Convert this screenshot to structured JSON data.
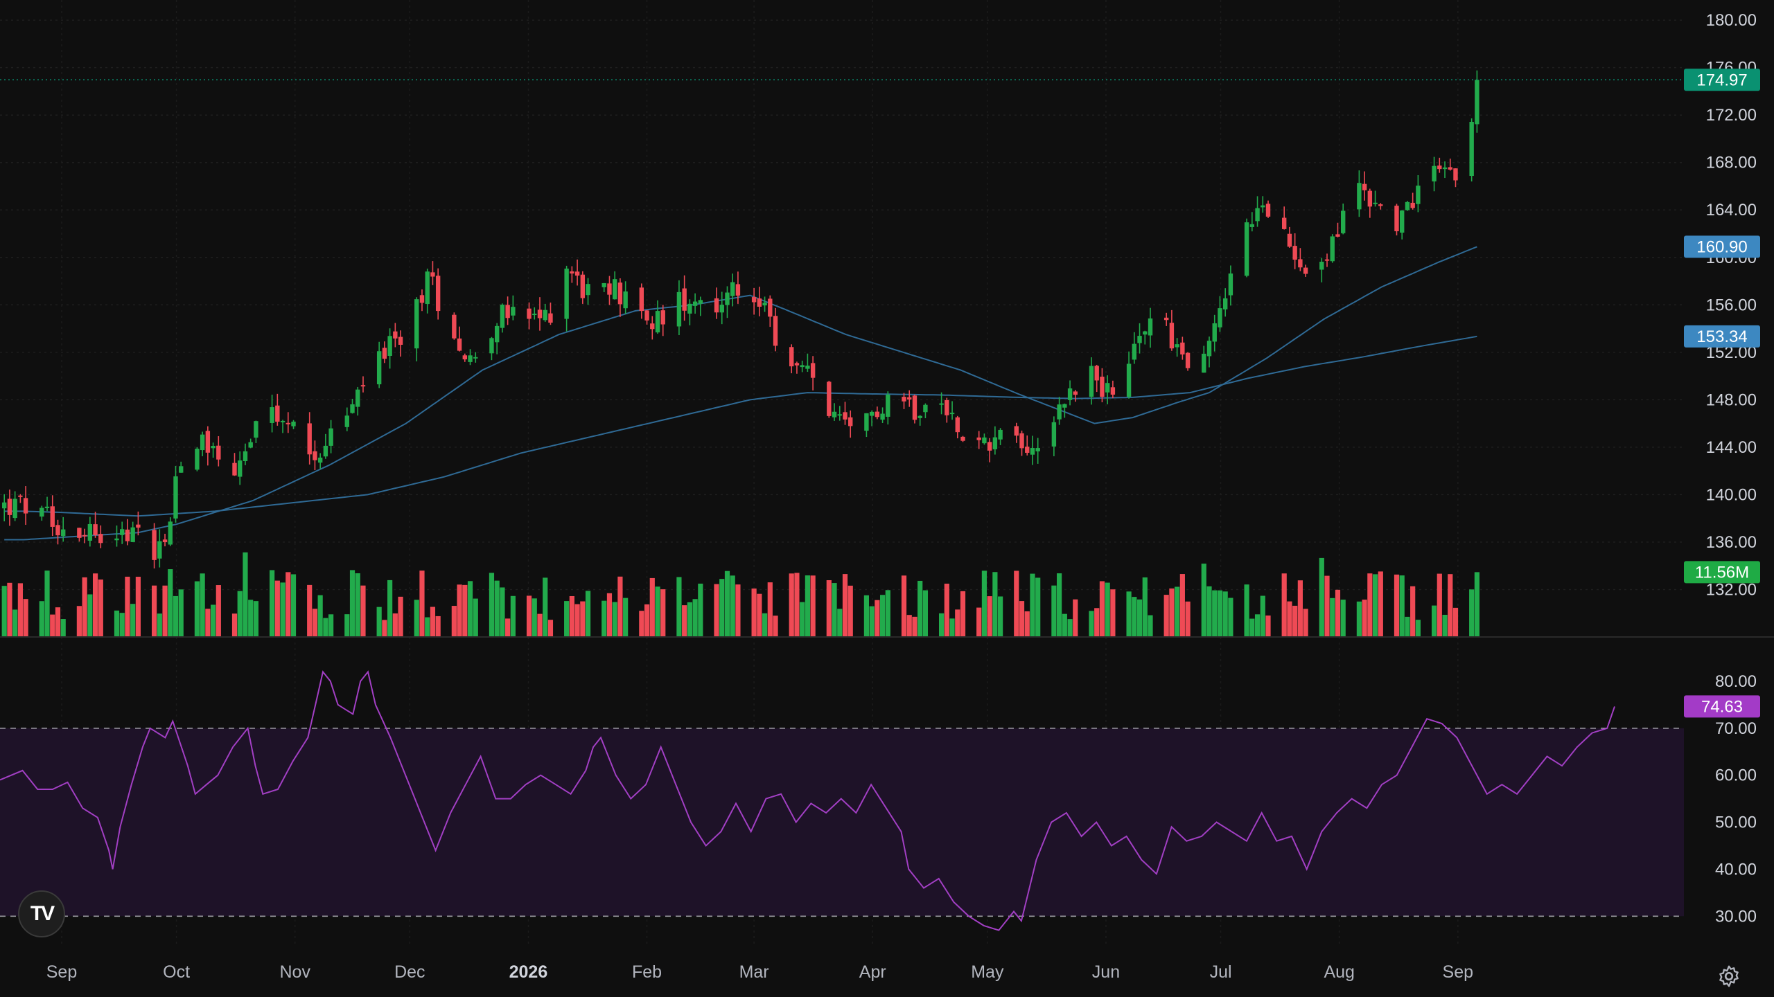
{
  "logo": {
    "text": "TV"
  },
  "icons": {
    "logo": "tradingview-logo-icon",
    "settings": "settings-gear-icon"
  },
  "colors": {
    "background": "#0f0f0f",
    "up": "#22ab4c",
    "down": "#ef4a55",
    "ma_line": "#2f6a95",
    "rsi_line": "#a23fc4",
    "rsi_band": "#1e1228",
    "price_badge": "#0a9171",
    "ma_badge": "#3d88c1",
    "volume_badge": "#1fab45",
    "rsi_badge": "#a33bc7"
  },
  "chart_data": {
    "type": "candlestick",
    "x_axis": {
      "ticks": [
        {
          "label": "Sep",
          "day": 0
        },
        {
          "label": "Oct",
          "day": 30
        },
        {
          "label": "Nov",
          "day": 61
        },
        {
          "label": "Dec",
          "day": 91
        },
        {
          "label": "2026",
          "day": 122,
          "bold": true
        },
        {
          "label": "Feb",
          "day": 153
        },
        {
          "label": "Mar",
          "day": 181
        },
        {
          "label": "Apr",
          "day": 212
        },
        {
          "label": "May",
          "day": 242
        },
        {
          "label": "Jun",
          "day": 273
        },
        {
          "label": "Jul",
          "day": 303
        },
        {
          "label": "Aug",
          "day": 334
        },
        {
          "label": "Sep",
          "day": 365
        }
      ]
    },
    "price_axis": {
      "ylim": [
        128,
        181
      ],
      "ticks": [
        180,
        176,
        172,
        168,
        164,
        160,
        156,
        152,
        148,
        144,
        140,
        136,
        132
      ],
      "tick_labels": [
        "180.00",
        "176.00",
        "172.00",
        "168.00",
        "164.00",
        "160.00",
        "156.00",
        "152.00",
        "148.00",
        "144.00",
        "140.00",
        "136.00",
        "132.00"
      ]
    },
    "price_waypoints": [
      [
        -10,
        139
      ],
      [
        0,
        137.3
      ],
      [
        10,
        137
      ],
      [
        20,
        136.5
      ],
      [
        24,
        135.5
      ],
      [
        28,
        137
      ],
      [
        30,
        142
      ],
      [
        33,
        145
      ],
      [
        38,
        144.5
      ],
      [
        45,
        142
      ],
      [
        50,
        145
      ],
      [
        55,
        146.5
      ],
      [
        60,
        145.5
      ],
      [
        66,
        143.5
      ],
      [
        72,
        145.5
      ],
      [
        78,
        148.5
      ],
      [
        82,
        152
      ],
      [
        88,
        152.5
      ],
      [
        92,
        155.5
      ],
      [
        96,
        158.5
      ],
      [
        100,
        155
      ],
      [
        104,
        153
      ],
      [
        106,
        151
      ],
      [
        110,
        153
      ],
      [
        114,
        155
      ],
      [
        120,
        155
      ],
      [
        124,
        154.5
      ],
      [
        128,
        155.5
      ],
      [
        132,
        159.5
      ],
      [
        136,
        157.5
      ],
      [
        140,
        156.5
      ],
      [
        145,
        157.5
      ],
      [
        150,
        155
      ],
      [
        155,
        154.5
      ],
      [
        160,
        156
      ],
      [
        165,
        157
      ],
      [
        170,
        156
      ],
      [
        176,
        157
      ],
      [
        180,
        157.5
      ],
      [
        184,
        155
      ],
      [
        188,
        152
      ],
      [
        192,
        150.5
      ],
      [
        196,
        150
      ],
      [
        200,
        147.5
      ],
      [
        204,
        145.5
      ],
      [
        208,
        144.5
      ],
      [
        212,
        147
      ],
      [
        218,
        149
      ],
      [
        224,
        147
      ],
      [
        230,
        147.5
      ],
      [
        236,
        145.5
      ],
      [
        240,
        144
      ],
      [
        246,
        145.5
      ],
      [
        250,
        144.5
      ],
      [
        254,
        144
      ],
      [
        258,
        146
      ],
      [
        262,
        148
      ],
      [
        266,
        149.5
      ],
      [
        270,
        150.5
      ],
      [
        274,
        148
      ],
      [
        276,
        147.5
      ],
      [
        280,
        152
      ],
      [
        284,
        154.5
      ],
      [
        288,
        155
      ],
      [
        292,
        152
      ],
      [
        296,
        150
      ],
      [
        300,
        153
      ],
      [
        304,
        157
      ],
      [
        308,
        161
      ],
      [
        312,
        164
      ],
      [
        316,
        163
      ],
      [
        320,
        161.5
      ],
      [
        324,
        160
      ],
      [
        328,
        158.5
      ],
      [
        332,
        161
      ],
      [
        336,
        164
      ],
      [
        338,
        167
      ],
      [
        342,
        165
      ],
      [
        346,
        163.5
      ],
      [
        350,
        163
      ],
      [
        354,
        165.5
      ],
      [
        358,
        167.5
      ],
      [
        360,
        168.5
      ],
      [
        362,
        168
      ],
      [
        364,
        166.5
      ],
      [
        366,
        168.5
      ],
      [
        368,
        169.5
      ],
      [
        370,
        174.97
      ]
    ],
    "moving_averages": [
      {
        "label": "160.90",
        "waypoints": [
          [
            -10,
            136.2
          ],
          [
            0,
            136.4
          ],
          [
            20,
            136.8
          ],
          [
            30,
            137.5
          ],
          [
            50,
            139.5
          ],
          [
            70,
            142.5
          ],
          [
            90,
            146
          ],
          [
            110,
            150.5
          ],
          [
            130,
            153.5
          ],
          [
            150,
            155.5
          ],
          [
            165,
            156
          ],
          [
            180,
            156.8
          ],
          [
            190,
            155.5
          ],
          [
            205,
            153.5
          ],
          [
            220,
            152
          ],
          [
            235,
            150.5
          ],
          [
            250,
            148.5
          ],
          [
            262,
            147
          ],
          [
            270,
            146
          ],
          [
            280,
            146.5
          ],
          [
            292,
            147.8
          ],
          [
            300,
            148.6
          ],
          [
            315,
            151.5
          ],
          [
            330,
            154.8
          ],
          [
            345,
            157.5
          ],
          [
            360,
            159.6
          ],
          [
            370,
            160.9
          ]
        ]
      },
      {
        "label": "153.34",
        "waypoints": [
          [
            -10,
            138.6
          ],
          [
            0,
            138.5
          ],
          [
            20,
            138.2
          ],
          [
            40,
            138.6
          ],
          [
            60,
            139.3
          ],
          [
            80,
            140
          ],
          [
            100,
            141.5
          ],
          [
            120,
            143.5
          ],
          [
            140,
            145
          ],
          [
            160,
            146.5
          ],
          [
            180,
            148
          ],
          [
            195,
            148.6
          ],
          [
            210,
            148.5
          ],
          [
            230,
            148.4
          ],
          [
            250,
            148.2
          ],
          [
            265,
            148.1
          ],
          [
            280,
            148.2
          ],
          [
            295,
            148.6
          ],
          [
            310,
            149.8
          ],
          [
            325,
            150.8
          ],
          [
            340,
            151.6
          ],
          [
            355,
            152.5
          ],
          [
            370,
            153.34
          ]
        ]
      }
    ],
    "volume": {
      "current_label": "11.56M",
      "current_value": 11.56,
      "ylim_volume": [
        0,
        28
      ]
    },
    "rsi": {
      "ylim": [
        24,
        85
      ],
      "ticks": [
        80,
        70,
        60,
        50,
        40,
        30
      ],
      "tick_labels": [
        "80.00",
        "70.00",
        "60.00",
        "50.00",
        "40.00",
        "30.00"
      ],
      "overbought": 70,
      "oversold": 30,
      "current_label": "74.63",
      "current_value": 74.63,
      "waypoints": [
        [
          -10,
          62
        ],
        [
          0,
          59
        ],
        [
          6,
          61
        ],
        [
          10,
          57
        ],
        [
          14,
          57
        ],
        [
          18,
          58.5
        ],
        [
          22,
          53
        ],
        [
          26,
          51
        ],
        [
          29,
          44
        ],
        [
          30,
          40
        ],
        [
          32,
          49
        ],
        [
          35,
          58
        ],
        [
          38,
          66
        ],
        [
          40,
          70
        ],
        [
          44,
          68
        ],
        [
          46,
          71.5
        ],
        [
          50,
          62
        ],
        [
          52,
          56
        ],
        [
          55,
          58
        ],
        [
          58,
          60
        ],
        [
          62,
          66
        ],
        [
          66,
          70
        ],
        [
          68,
          62
        ],
        [
          70,
          56
        ],
        [
          74,
          57
        ],
        [
          78,
          63
        ],
        [
          82,
          68
        ],
        [
          84,
          75
        ],
        [
          86,
          82
        ],
        [
          88,
          80
        ],
        [
          90,
          75
        ],
        [
          92,
          74
        ],
        [
          94,
          73
        ],
        [
          96,
          80
        ],
        [
          98,
          82
        ],
        [
          100,
          75
        ],
        [
          104,
          68
        ],
        [
          108,
          60
        ],
        [
          112,
          52
        ],
        [
          116,
          44
        ],
        [
          120,
          52
        ],
        [
          124,
          58
        ],
        [
          128,
          64
        ],
        [
          132,
          55
        ],
        [
          136,
          55
        ],
        [
          140,
          58
        ],
        [
          144,
          60
        ],
        [
          148,
          58
        ],
        [
          152,
          56
        ],
        [
          156,
          61
        ],
        [
          158,
          66
        ],
        [
          160,
          68
        ],
        [
          164,
          60
        ],
        [
          168,
          55
        ],
        [
          172,
          58
        ],
        [
          176,
          66
        ],
        [
          180,
          58
        ],
        [
          184,
          50
        ],
        [
          188,
          45
        ],
        [
          192,
          48
        ],
        [
          196,
          54
        ],
        [
          200,
          48
        ],
        [
          204,
          55
        ],
        [
          208,
          56
        ],
        [
          212,
          50
        ],
        [
          216,
          54
        ],
        [
          220,
          52
        ],
        [
          224,
          55
        ],
        [
          228,
          52
        ],
        [
          232,
          58
        ],
        [
          236,
          53
        ],
        [
          240,
          48
        ],
        [
          242,
          40
        ],
        [
          246,
          36
        ],
        [
          250,
          38
        ],
        [
          254,
          33
        ],
        [
          258,
          30
        ],
        [
          262,
          28
        ],
        [
          266,
          27
        ],
        [
          270,
          31
        ],
        [
          272,
          29
        ],
        [
          276,
          42
        ],
        [
          280,
          50
        ],
        [
          284,
          52
        ],
        [
          288,
          47
        ],
        [
          292,
          50
        ],
        [
          296,
          45
        ],
        [
          300,
          47
        ],
        [
          304,
          42
        ],
        [
          308,
          39
        ],
        [
          312,
          49
        ],
        [
          316,
          46
        ],
        [
          320,
          47
        ],
        [
          324,
          50
        ],
        [
          328,
          48
        ],
        [
          332,
          46
        ],
        [
          336,
          52
        ],
        [
          340,
          46
        ],
        [
          344,
          47
        ],
        [
          348,
          40
        ],
        [
          352,
          48
        ],
        [
          356,
          52
        ],
        [
          360,
          55
        ],
        [
          364,
          53
        ],
        [
          368,
          58
        ],
        [
          372,
          60
        ],
        [
          376,
          66
        ],
        [
          380,
          72
        ],
        [
          384,
          71
        ],
        [
          388,
          68
        ],
        [
          392,
          62
        ],
        [
          396,
          56
        ],
        [
          400,
          58
        ],
        [
          404,
          56
        ],
        [
          408,
          60
        ],
        [
          412,
          64
        ],
        [
          416,
          62
        ],
        [
          420,
          66
        ],
        [
          424,
          69
        ],
        [
          428,
          70
        ],
        [
          430,
          74.63
        ]
      ]
    },
    "last_price": {
      "label": "174.97",
      "value": 174.97
    }
  }
}
